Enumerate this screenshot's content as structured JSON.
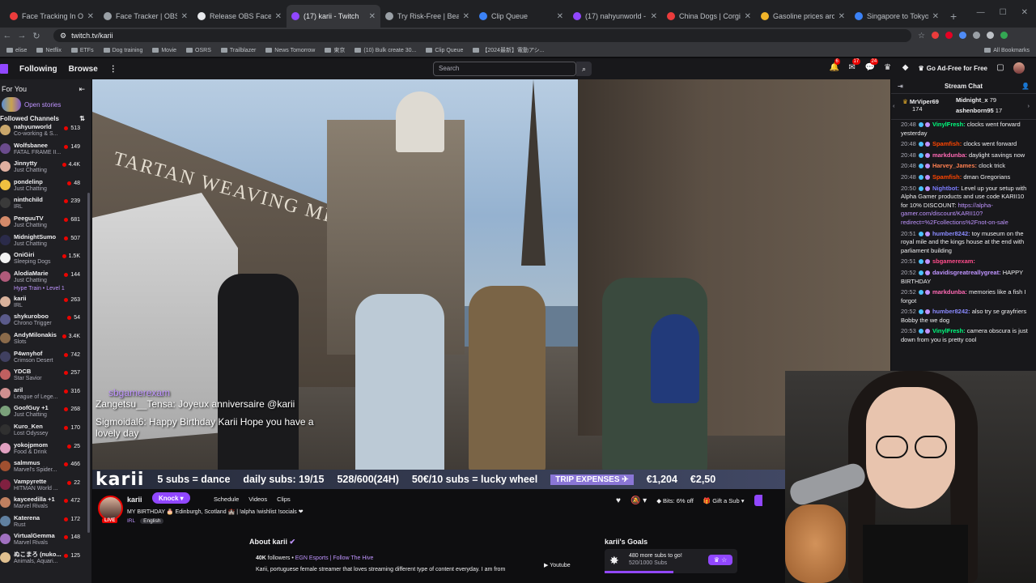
{
  "browser": {
    "tabs": [
      {
        "title": "Face Tracking In OBS | Compl",
        "color": "#eb3c3c"
      },
      {
        "title": "Face Tracker | OBS Forums",
        "color": "#9aa0a6"
      },
      {
        "title": "Release OBS Face Tracker 0.9",
        "color": "#e8eaed"
      },
      {
        "title": "(17) karii - Twitch",
        "color": "#9147ff",
        "active": true
      },
      {
        "title": "Try Risk-Free | Beam Eye Track",
        "color": "#9aa0a6"
      },
      {
        "title": "Clip Queue",
        "color": "#3b82f6"
      },
      {
        "title": "(17) nahyunworld - Twitch",
        "color": "#9147ff"
      },
      {
        "title": "China Dogs | Corgi Guides 7",
        "color": "#eb3c3c"
      },
      {
        "title": "Gasoline prices around the w",
        "color": "#f0b429"
      },
      {
        "title": "Singapore to Tokyo | Google",
        "color": "#3b82f6"
      }
    ],
    "url": "twitch.tv/karii",
    "bookmarks": [
      "elise",
      "Netflix",
      "ETFs",
      "Dog training",
      "Movie",
      "OSRS",
      "Trailblazer",
      "News Tomorrow",
      "東京",
      "(10) Bulk create 30...",
      "Clip Queue",
      "【2024最新】電動アシ..."
    ],
    "all_bookmarks": "All Bookmarks"
  },
  "twitch": {
    "nav": {
      "following": "Following",
      "browse": "Browse",
      "search_placeholder": "Search",
      "ad_free": "Go Ad-Free for Free"
    },
    "badges": {
      "notif": "6",
      "inbox": "17",
      "whisper": "24"
    },
    "sidebar": {
      "for_you": "For You",
      "open_stories": "Open stories",
      "followed": "Followed Channels",
      "channels": [
        {
          "name": "nahyunworld",
          "game": "Co-working & S...",
          "viewers": "513",
          "color": "#c9a66b"
        },
        {
          "name": "Wolfsbanee",
          "game": "FATAL FRAME II...",
          "viewers": "149",
          "color": "#6a4b8c"
        },
        {
          "name": "Jinnytty",
          "game": "Just Chatting",
          "viewers": "4.4K",
          "color": "#e0b0a0"
        },
        {
          "name": "pondelinp",
          "game": "Just Chatting",
          "viewers": "48",
          "color": "#f0c040"
        },
        {
          "name": "ninthchild",
          "game": "IRL",
          "viewers": "239",
          "color": "#3a3a3a"
        },
        {
          "name": "PeeguuTV",
          "game": "Just Chatting",
          "viewers": "681",
          "color": "#d48a6a"
        },
        {
          "name": "MidnightSumo",
          "game": "Just Chatting",
          "viewers": "507",
          "color": "#2b2b4a"
        },
        {
          "name": "OniGiri",
          "game": "Sleeping Dogs",
          "viewers": "1.5K",
          "color": "#f2f2f2"
        },
        {
          "name": "AlodiaMarie",
          "game": "Just Chatting",
          "viewers": "144",
          "color": "#b05a7a"
        },
        {
          "name": "karii",
          "game": "IRL",
          "viewers": "263",
          "color": "#d9b29c"
        },
        {
          "name": "shykuroboo",
          "game": "Chrono Trigger",
          "viewers": "54",
          "color": "#5a5a8a"
        },
        {
          "name": "AndyMilonakis",
          "game": "Slots",
          "viewers": "3.4K",
          "color": "#8a6a4a"
        },
        {
          "name": "P4wnyhof",
          "game": "Crimson Desert",
          "viewers": "742",
          "color": "#404060"
        },
        {
          "name": "YDCB",
          "game": "Star Savior",
          "viewers": "257",
          "color": "#c06060"
        },
        {
          "name": "aril",
          "game": "League of Lege...",
          "viewers": "316",
          "color": "#d09090"
        },
        {
          "name": "GoofGuy +1",
          "game": "Just Chatting",
          "viewers": "268",
          "color": "#7aa07a"
        },
        {
          "name": "Kuro_Ken",
          "game": "Lost Odyssey",
          "viewers": "170",
          "color": "#303030"
        },
        {
          "name": "yokojpmom",
          "game": "Food & Drink",
          "viewers": "25",
          "color": "#e0a0c0"
        },
        {
          "name": "salmmus",
          "game": "Marvel's Spider...",
          "viewers": "466",
          "color": "#a05030"
        },
        {
          "name": "Vampyrette",
          "game": "HITMAN World ...",
          "viewers": "22",
          "color": "#802040"
        },
        {
          "name": "kayceedilla +1",
          "game": "Marvel Rivals",
          "viewers": "472",
          "color": "#c08060"
        },
        {
          "name": "Katerena",
          "game": "Rust",
          "viewers": "172",
          "color": "#6080a0"
        },
        {
          "name": "VirtualGemma",
          "game": "Marvel Rivals",
          "viewers": "148",
          "color": "#a070c0"
        },
        {
          "name": "ぬこまろ (nuko...",
          "game": "Animals, Aquari...",
          "viewers": "125",
          "color": "#e0c090"
        }
      ],
      "hype_train": "Hype Train • Level 1"
    },
    "video": {
      "sign_text": "TARTAN WEAVING MILL",
      "overlay": [
        {
          "user": "sbgamerexam",
          "text": ""
        },
        {
          "user": "Zangetsu__Tensa:",
          "text": "Joyeux anniversaire @karii"
        },
        {
          "user": "Sigmoidal6:",
          "text": "Happy Birthday Karii Hope you have a lovely day"
        }
      ],
      "ticker": {
        "name": "karii",
        "items": [
          "5 subs = dance",
          "daily subs: 19/15",
          "528/600(24H)",
          "50€/10 subs = lucky wheel"
        ],
        "trip": "TRIP EXPENSES ✈",
        "trip_value": "€1,204",
        "trip_cut": "€2,50"
      }
    },
    "channel": {
      "name": "karii",
      "live": "LIVE",
      "knock": "Knock",
      "tabs": [
        "Schedule",
        "Videos",
        "Clips"
      ],
      "title": "MY BIRTHDAY 🎂 Edinburgh, Scotland 🏰 | !alpha !wishlist !socials ❤",
      "category": "IRL",
      "language": "English",
      "bits": "Bits: 6% off",
      "gift": "Gift a Sub",
      "about": "About karii",
      "followers_count": "40K",
      "followers_label": "followers",
      "org": "EGN Esports | Follow The Hive",
      "description": "Karii, portuguese female streamer that loves streaming different type of content everyday. I am from",
      "youtube": "Youtube",
      "goals_title": "karii's Goals",
      "goal_text": "480 more subs to go!",
      "goal_sub": "520/1000 Subs",
      "goal_progress": 0.52
    },
    "chat": {
      "title": "Stream Chat",
      "pinned": [
        {
          "name": "MrViper69",
          "value": "174"
        },
        {
          "name": "Midnight_x",
          "value": "79"
        },
        {
          "name": "ashenborn95",
          "value": "17"
        }
      ],
      "messages": [
        {
          "time": "20:48",
          "user": "VinylFresh:",
          "color": "#00ff7f",
          "text": "clocks went forward yesterday"
        },
        {
          "time": "20:48",
          "user": "Spamfish:",
          "color": "#ff4500",
          "text": "clocks went forward"
        },
        {
          "time": "20:48",
          "user": "markdunba:",
          "color": "#ff69b4",
          "text": "daylight savings now"
        },
        {
          "time": "20:48",
          "user": "Harvey_James:",
          "color": "#ff7f50",
          "text": "clock trick"
        },
        {
          "time": "20:48",
          "user": "Spamfish:",
          "color": "#ff4500",
          "text": "dman Gregorians"
        },
        {
          "time": "20:50",
          "user": "Nightbot:",
          "color": "#7c7cff",
          "text": "Level up your setup with Alpha Gamer products and use code KARII10 for 10% DISCOUNT:",
          "link": "https://alpha-gamer.com/discount/KARII10?redirect=%2Fcollections%2Fnot-on-sale"
        },
        {
          "time": "20:51",
          "user": "humber8242:",
          "color": "#8a8aff",
          "text": "toy museum on the royal mile and the kings house at the end with parliament building"
        },
        {
          "time": "20:51",
          "user": "sbgamerexam:",
          "color": "#ff4c8b",
          "text": ""
        },
        {
          "time": "20:52",
          "user": "davidisgreatreallygreat:",
          "color": "#bf94ff",
          "text": "HAPPY BIRTHDAY"
        },
        {
          "time": "20:52",
          "user": "markdunba:",
          "color": "#ff69b4",
          "text": "memories like a fish I forgot"
        },
        {
          "time": "20:52",
          "user": "humber8242:",
          "color": "#8a8aff",
          "text": "also try se grayfriers Bobby the we dog"
        },
        {
          "time": "20:53",
          "user": "VinylFresh:",
          "color": "#00ff7f",
          "text": "camera obscura is just down from you is pretty cool"
        }
      ]
    }
  }
}
